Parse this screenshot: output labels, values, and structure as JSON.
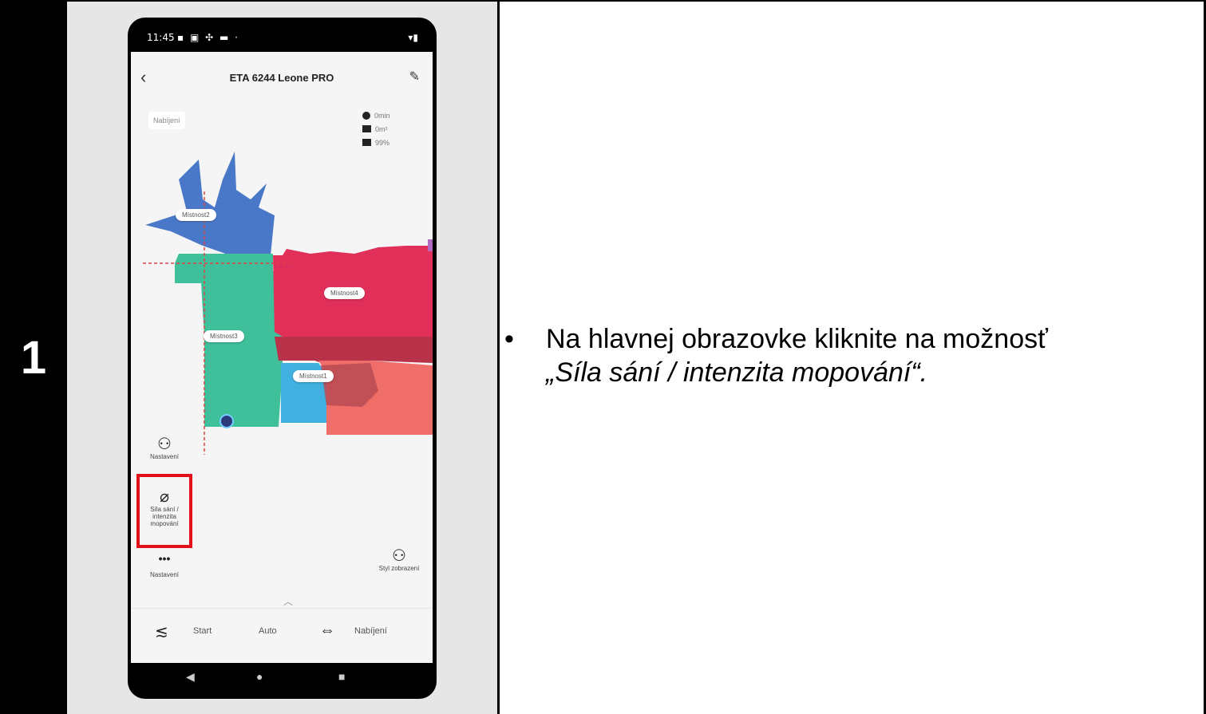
{
  "step": {
    "number": "1"
  },
  "phone": {
    "status": {
      "time": "11:45",
      "icons": "▪ ▣ ✣ ▬ ·",
      "right": "▾▮"
    },
    "header": {
      "title": "ETA 6244 Leone PRO"
    },
    "state_label": "Nabíjení",
    "info": [
      {
        "icon": "clock-icon",
        "text": "0min"
      },
      {
        "icon": "area-icon",
        "text": "0m²"
      },
      {
        "icon": "battery-icon",
        "text": "99%"
      }
    ],
    "rooms": {
      "room2": "Místnost2",
      "room4": "Místnost4",
      "room3": "Místnost3",
      "room1": "Místnost1"
    },
    "side_buttons": {
      "map_edit": "Nastavení",
      "suction": "Síla sání / intenzita mopování",
      "settings": "Nastavení",
      "display_style": "Styl zobrazení"
    },
    "bottom_bar": {
      "start": "Start",
      "mode": "Auto",
      "charge": "Nabíjení"
    },
    "highlight_color": "#e3101b"
  },
  "instruction": {
    "bullet": "•",
    "line1": "Na hlavnej obrazovke kliknite na možnosť",
    "line2": "„Síla sání / intenzita mopování“."
  }
}
